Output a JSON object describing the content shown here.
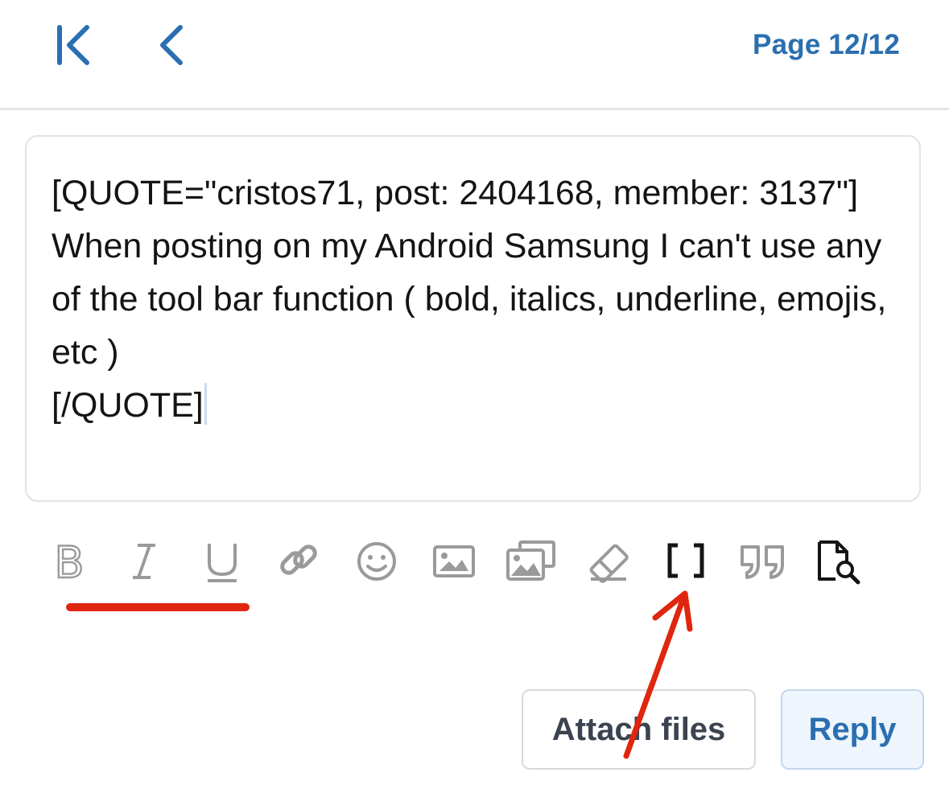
{
  "header": {
    "first_icon": "first-page-icon",
    "prev_icon": "chevron-left-icon",
    "page_indicator": "Page 12/12",
    "accent_color": "#2a6fb0"
  },
  "editor": {
    "text": "[QUOTE=\"cristos71, post: 2404168, member: 3137\"]\nWhen posting on my Android Samsung I can't use any of the tool bar function ( bold, italics, underline, emojis, etc )\n[/QUOTE]"
  },
  "toolbar": {
    "items": [
      {
        "name": "bold",
        "icon": "bold-icon",
        "label": "B"
      },
      {
        "name": "italic",
        "icon": "italic-icon",
        "label": "I"
      },
      {
        "name": "underline",
        "icon": "underline-icon",
        "label": "U"
      },
      {
        "name": "link",
        "icon": "link-icon"
      },
      {
        "name": "emoji",
        "icon": "smiley-icon"
      },
      {
        "name": "image",
        "icon": "image-icon"
      },
      {
        "name": "media",
        "icon": "media-gallery-icon"
      },
      {
        "name": "clear-formatting",
        "icon": "eraser-icon"
      },
      {
        "name": "bbcode-toggle",
        "icon": "brackets-icon",
        "label": "[ ]"
      },
      {
        "name": "quote",
        "icon": "quote-icon"
      },
      {
        "name": "preview",
        "icon": "preview-search-icon"
      }
    ],
    "icon_color": "#9a9a9a",
    "active_icon_color": "#141414"
  },
  "annotations": {
    "color": "#e0260f"
  },
  "actions": {
    "attach_label": "Attach files",
    "reply_label": "Reply"
  }
}
